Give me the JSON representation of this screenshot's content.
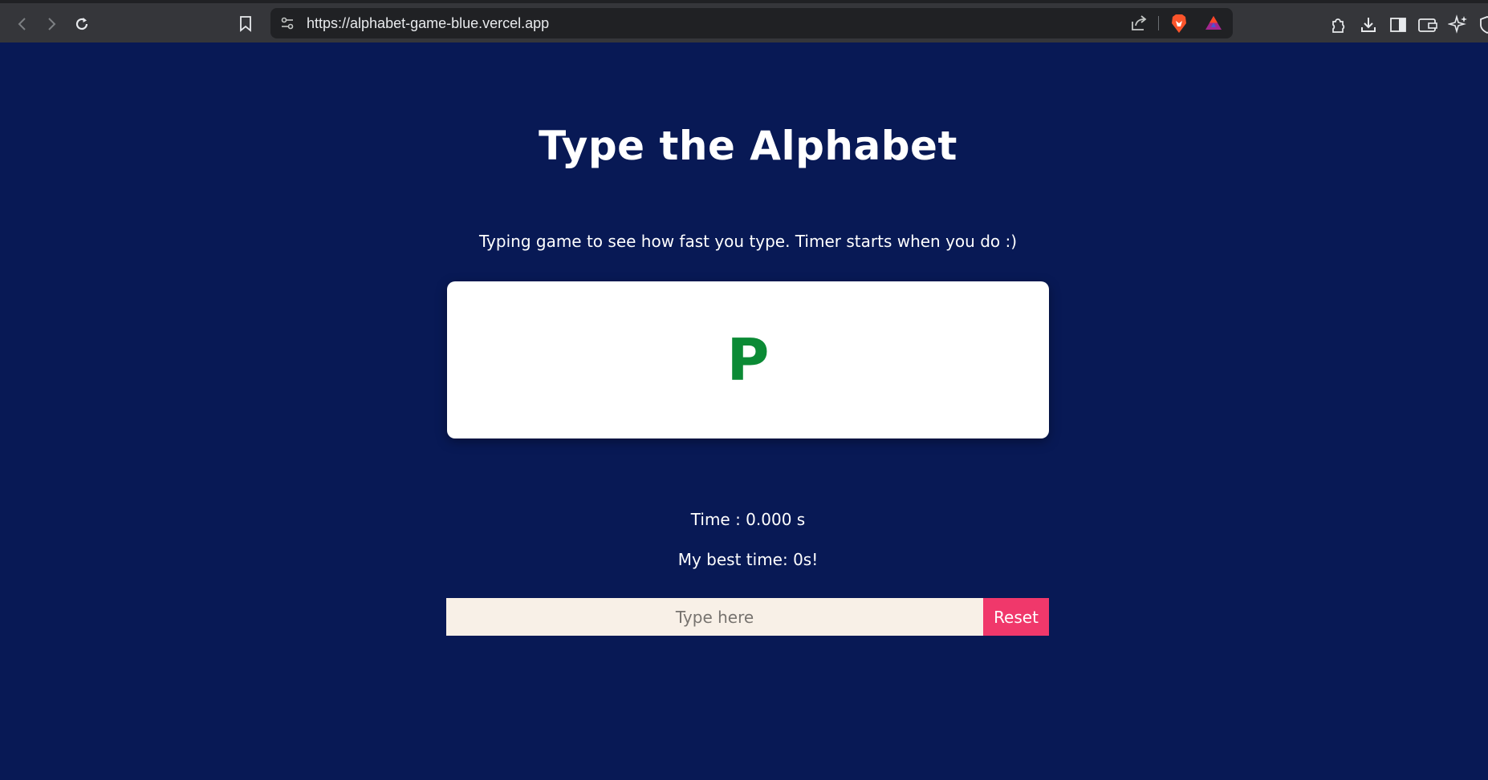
{
  "browser": {
    "url": "https://alphabet-game-blue.vercel.app",
    "icons": [
      "back-icon",
      "forward-icon",
      "reload-icon",
      "bookmark-icon",
      "site-settings-icon",
      "share-icon",
      "brave-shields-icon",
      "brave-rewards-icon",
      "extensions-icon",
      "downloads-icon",
      "sidebar-icon",
      "wallet-icon",
      "leo-ai-icon",
      "vpn-icon"
    ]
  },
  "page": {
    "title": "Type the Alphabet",
    "subtitle": "Typing game to see how fast you type. Timer starts when you do :)",
    "current_letter": "P",
    "timer": "Time : 0.000 s",
    "best_time": "My best time: 0s!",
    "input_placeholder": "Type here",
    "input_value": "",
    "reset_label": "Reset"
  },
  "colors": {
    "background": "#081955",
    "letter": "#0b8a35",
    "reset_button": "#f0386b",
    "input_background": "#f8f0e7"
  }
}
